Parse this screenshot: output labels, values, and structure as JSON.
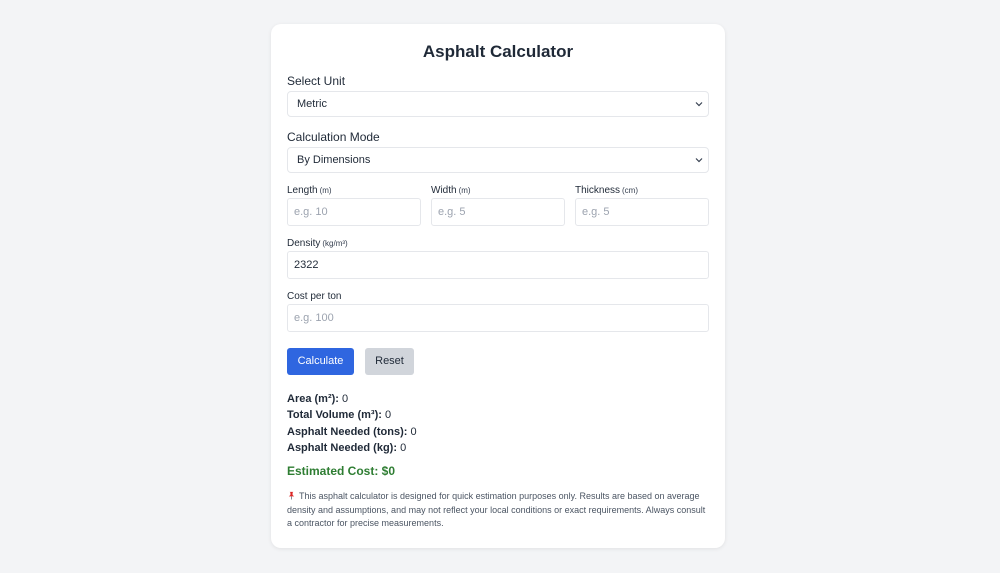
{
  "title": "Asphalt Calculator",
  "unit": {
    "label": "Select Unit",
    "selected": "Metric"
  },
  "mode": {
    "label": "Calculation Mode",
    "selected": "By Dimensions"
  },
  "length": {
    "label": "Length",
    "unit": "(m)",
    "placeholder": "e.g. 10"
  },
  "width": {
    "label": "Width",
    "unit": "(m)",
    "placeholder": "e.g. 5"
  },
  "thickness": {
    "label": "Thickness",
    "unit": "(cm)",
    "placeholder": "e.g. 5"
  },
  "density": {
    "label": "Density",
    "unit": "(kg/m³)",
    "value": "2322"
  },
  "cost_per_ton": {
    "label": "Cost per ton",
    "placeholder": "e.g. 100"
  },
  "buttons": {
    "calculate": "Calculate",
    "reset": "Reset"
  },
  "results": {
    "area_label": "Area (m²):",
    "area_value": "0",
    "volume_label": "Total Volume (m³):",
    "volume_value": "0",
    "tons_label": "Asphalt Needed (tons):",
    "tons_value": "0",
    "kg_label": "Asphalt Needed (kg):",
    "kg_value": "0",
    "cost_label": "Estimated Cost: $",
    "cost_value": "0"
  },
  "disclaimer": "This asphalt calculator is designed for quick estimation purposes only. Results are based on average density and assumptions, and may not reflect your local conditions or exact requirements. Always consult a contractor for precise measurements.",
  "colors": {
    "primary_button": "#2f66e0",
    "cost_text": "#2e7d32",
    "pin": "#dc2626"
  },
  "icons": {
    "select_arrow": "chevron-down-icon",
    "note": "pin-icon"
  }
}
